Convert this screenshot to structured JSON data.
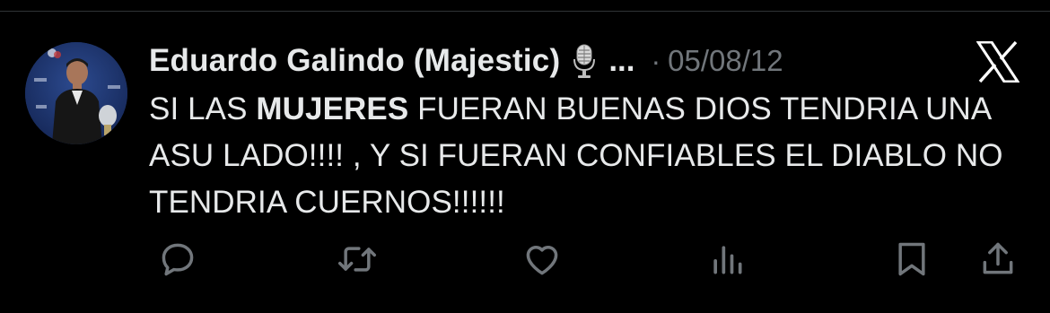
{
  "tweet": {
    "display_name": "Eduardo Galindo (Majestic)",
    "badge_icon": "microphone-icon",
    "truncation": "...",
    "separator": "·",
    "timestamp": "05/08/12",
    "text_part1": "SI LAS ",
    "text_bold": "MUJERES",
    "text_part2": " FUERAN BUENAS DIOS TENDRIA UNA ASU LADO!!!! , Y SI FUERAN CONFIABLES EL DIABLO NO TENDRIA CUERNOS!!!!!!"
  },
  "actions": [
    {
      "name": "reply",
      "icon": "reply-icon"
    },
    {
      "name": "retweet",
      "icon": "retweet-icon"
    },
    {
      "name": "like",
      "icon": "heart-icon"
    },
    {
      "name": "views",
      "icon": "views-icon"
    },
    {
      "name": "bookmark",
      "icon": "bookmark-icon"
    },
    {
      "name": "share",
      "icon": "share-icon"
    }
  ],
  "colors": {
    "background": "#000000",
    "text": "#e7e9ea",
    "secondary": "#71767b",
    "divider": "#2f3336"
  },
  "brand": {
    "logo": "x-logo-icon"
  }
}
